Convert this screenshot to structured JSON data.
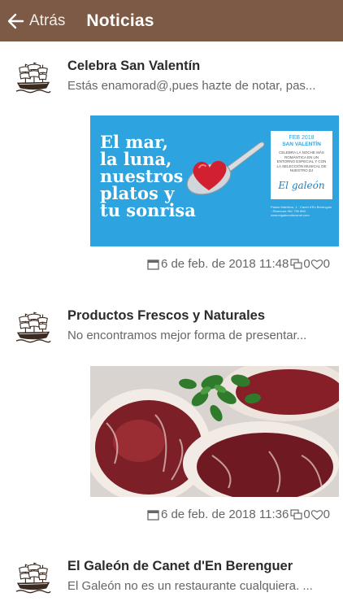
{
  "header": {
    "back_label": "Atrás",
    "title": "Noticias",
    "bg_color": "#7c5a45"
  },
  "posts": [
    {
      "title": "Celebra San Valentín",
      "excerpt": "Estás enamorad@,pues hazte de notar, pas...",
      "date": "6 de feb. de 2018 11:48",
      "comments": "0",
      "likes": "0",
      "image": {
        "headline": [
          "El mar,",
          "la luna,",
          "nuestros",
          "platos y",
          "tu sonrisa"
        ],
        "card_date": "FEB 2018",
        "card_title": "SAN VALENTÍN",
        "card_text": "CELEBRA LA NOCHE MÁS ROMÁNTICA EN UN ENTORNO ESPECIAL Y CON LA SELECCIÓN MUSICAL DE NUESTRO DJ",
        "card_logo": "El galeón",
        "small_print": "Paseo Marítimo, 1 · Canet d'En Berenguer · Reservas 961 795 868 · www.elgaleondecanet.com"
      }
    },
    {
      "title": "Productos Frescos y Naturales",
      "excerpt": "No encontramos mejor forma de presentar...",
      "date": "6 de feb. de 2018 11:36",
      "comments": "0",
      "likes": "0"
    },
    {
      "title": "El Galeón de Canet d'En Berenguer",
      "excerpt": "El Galeón no es un restaurante cualquiera. ..."
    }
  ],
  "icons": {
    "back": "arrow-left-icon",
    "avatar": "ship-logo",
    "date": "calendar-icon",
    "comments": "comments-icon",
    "likes": "heart-icon"
  }
}
